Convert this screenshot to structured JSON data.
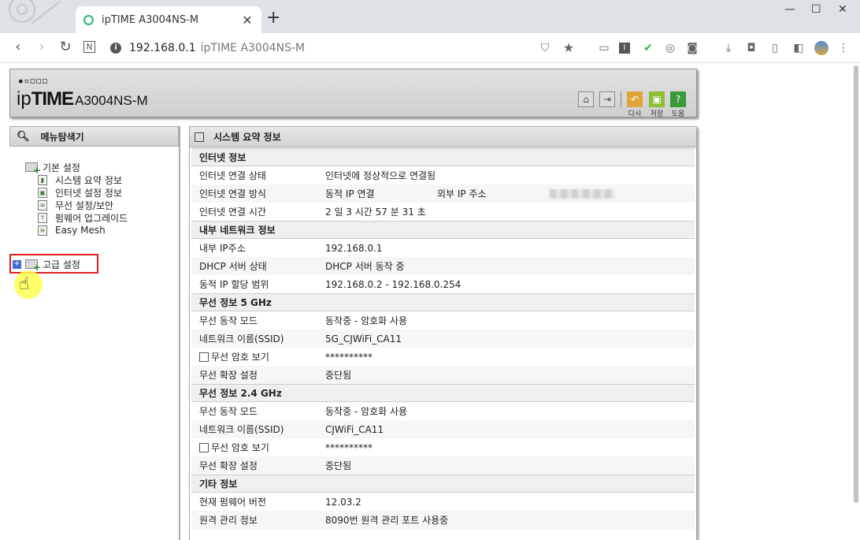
{
  "browser": {
    "tab_title": "ipTIME A3004NS-M",
    "tab_close": "✕",
    "new_tab": "+",
    "address_host": "192.168.0.1",
    "address_title": "ipTIME A3004NS-M",
    "info_glyph": "i"
  },
  "router": {
    "logo_dots": "▪▫◻◻◻",
    "logo_ip": "ip",
    "logo_time": "TIME",
    "logo_model": "A3004NS-M",
    "btn_refresh_label": "다시",
    "btn_save_label": "저장",
    "btn_help_label": "도움",
    "btn_help_glyph": "?"
  },
  "menu": {
    "title": "메뉴탐색기",
    "basic": "기본 설정",
    "items": [
      "시스템 요약 정보",
      "인터넷 설정 정보",
      "무선 설정/보안",
      "펌웨어 업그레이드",
      "Easy Mesh"
    ],
    "advanced": "고급 설정"
  },
  "main": {
    "title": "시스템 요약 정보",
    "internet": {
      "title": "인터넷 정보",
      "status_k": "인터넷 연결 상태",
      "status_v": "인터넷에 정상적으로 연결됨",
      "method_k": "인터넷 연결 방식",
      "method_v": "동적 IP 연결",
      "ext_ip_k": "외부 IP 주소",
      "time_k": "인터넷 연결 시간",
      "time_v": "2 일 3 시간 57 분 31 초"
    },
    "lan": {
      "title": "내부 네트워크 정보",
      "ip_k": "내부 IP주소",
      "ip_v": "192.168.0.1",
      "dhcp_k": "DHCP 서버 상태",
      "dhcp_v": "DHCP 서버 동작 중",
      "range_k": "동적 IP 할당 범위",
      "range_v": "192.168.0.2 -  192.168.0.254"
    },
    "wifi5": {
      "title": "무선 정보 5 GHz",
      "mode_k": "무선 동작 모드",
      "mode_v": "동작중 - 암호화 사용",
      "ssid_k": "네트워크 이름(SSID)",
      "ssid_v": "5G_CJWiFi_CA11",
      "pw_k": "무선 암호 보기",
      "pw_v": "**********",
      "ext_k": "무선 확장 설정",
      "ext_v": "중단됨"
    },
    "wifi24": {
      "title": "무선 정보 2.4 GHz",
      "mode_k": "무선 동작 모드",
      "mode_v": "동작중 - 암호화 사용",
      "ssid_k": "네트워크 이름(SSID)",
      "ssid_v": "CJWiFi_CA11",
      "pw_k": "무선 암호 보기",
      "pw_v": "**********",
      "ext_k": "무선 확장 설정",
      "ext_v": "중단됨"
    },
    "etc": {
      "title": "기타 정보",
      "fw_k": "현재 펌웨어 버전",
      "fw_v": "12.03.2",
      "remote_k": "원격 관리 정보",
      "remote_v": "8090번 원격 관리 포트 사용중"
    }
  }
}
